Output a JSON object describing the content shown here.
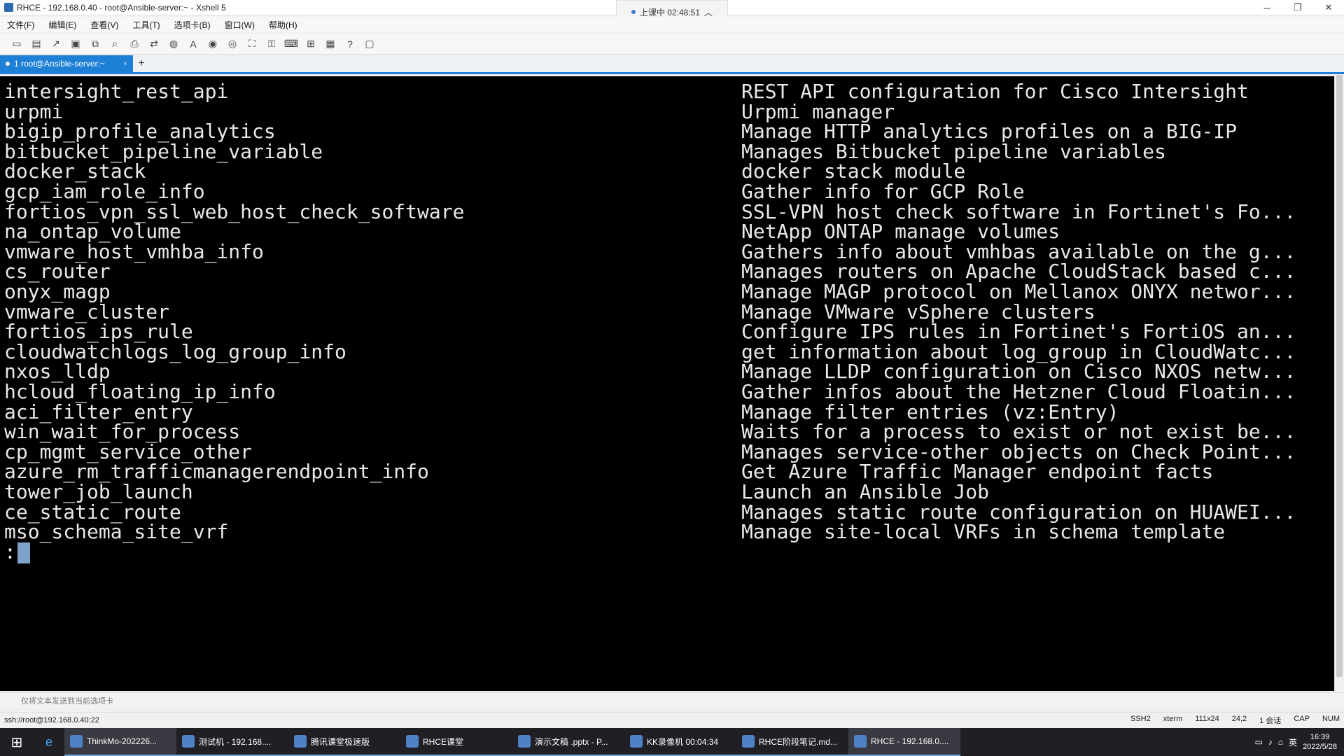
{
  "window": {
    "title": "RHCE - 192.168.0.40 - root@Ansible-server:~ - Xshell 5",
    "live_label": "上课中 02:48:51",
    "minimize": "─",
    "maximize": "❐",
    "close": "✕"
  },
  "menu": [
    "文件(F)",
    "编辑(E)",
    "查看(V)",
    "工具(T)",
    "选项卡(B)",
    "窗口(W)",
    "帮助(H)"
  ],
  "tab": {
    "label": "1 root@Ansible-server:~",
    "close": "×",
    "add": "+"
  },
  "terminal": {
    "lines": [
      [
        "intersight_rest_api",
        "REST API configuration for Cisco Intersight"
      ],
      [
        "urpmi",
        "Urpmi manager"
      ],
      [
        "bigip_profile_analytics",
        "Manage HTTP analytics profiles on a BIG-IP"
      ],
      [
        "bitbucket_pipeline_variable",
        "Manages Bitbucket pipeline variables"
      ],
      [
        "docker_stack",
        "docker stack module"
      ],
      [
        "gcp_iam_role_info",
        "Gather info for GCP Role"
      ],
      [
        "fortios_vpn_ssl_web_host_check_software",
        "SSL-VPN host check software in Fortinet's Fo..."
      ],
      [
        "na_ontap_volume",
        "NetApp ONTAP manage volumes"
      ],
      [
        "vmware_host_vmhba_info",
        "Gathers info about vmhbas available on the g..."
      ],
      [
        "cs_router",
        "Manages routers on Apache CloudStack based c..."
      ],
      [
        "onyx_magp",
        "Manage MAGP protocol on Mellanox ONYX networ..."
      ],
      [
        "vmware_cluster",
        "Manage VMware vSphere clusters"
      ],
      [
        "fortios_ips_rule",
        "Configure IPS rules in Fortinet's FortiOS an..."
      ],
      [
        "cloudwatchlogs_log_group_info",
        "get information about log_group in CloudWatc..."
      ],
      [
        "nxos_lldp",
        "Manage LLDP configuration on Cisco NXOS netw..."
      ],
      [
        "hcloud_floating_ip_info",
        "Gather infos about the Hetzner Cloud Floatin..."
      ],
      [
        "aci_filter_entry",
        "Manage filter entries (vz:Entry)"
      ],
      [
        "win_wait_for_process",
        "Waits for a process to exist or not exist be..."
      ],
      [
        "cp_mgmt_service_other",
        "Manages service-other objects on Check Point..."
      ],
      [
        "azure_rm_trafficmanagerendpoint_info",
        "Get Azure Traffic Manager endpoint facts"
      ],
      [
        "tower_job_launch",
        "Launch an Ansible Job"
      ],
      [
        "ce_static_route",
        "Manages static route configuration on HUAWEI..."
      ],
      [
        "mso_schema_site_vrf",
        "Manage site-local VRFs in schema template"
      ]
    ],
    "prompt": ":"
  },
  "sendbar": {
    "text": "仅将文本发送到当前选项卡"
  },
  "status": {
    "connection": "ssh://root@192.168.0.40:22",
    "protocol": "SSH2",
    "term": "xterm",
    "size": "111x24",
    "pos": "24,2",
    "sessions": "1 会话",
    "caps": "CAP",
    "num": "NUM"
  },
  "taskbar": {
    "items": [
      {
        "label": "ThinkMo-202226...",
        "active": true
      },
      {
        "label": "测试机 - 192.168....",
        "active": false
      },
      {
        "label": "腾讯课堂极速版",
        "active": false
      },
      {
        "label": "RHCE课堂",
        "active": false
      },
      {
        "label": "演示文稿 .pptx - P...",
        "active": false
      },
      {
        "label": "KK录像机 00:04:34",
        "active": false
      },
      {
        "label": "RHCE阶段笔记.md...",
        "active": false
      },
      {
        "label": "RHCE - 192.168.0....",
        "active": true
      }
    ],
    "ime": "英",
    "time": "16:39",
    "date": "2022/5/28"
  },
  "colors": {
    "accent": "#1e7fd6",
    "terminal_bg": "#000000",
    "terminal_fg": "#e9e9e9"
  }
}
